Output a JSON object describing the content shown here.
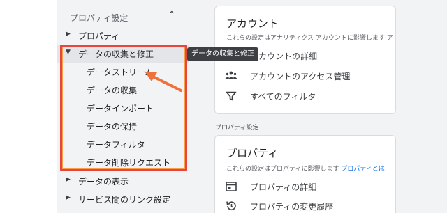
{
  "sidebar": {
    "header": "プロパティ設定",
    "items": [
      {
        "label": "プロパティ",
        "expanded": false
      },
      {
        "label": "データの収集と修正",
        "expanded": true
      },
      {
        "label": "データの表示",
        "expanded": false
      },
      {
        "label": "サービス間のリンク設定",
        "expanded": false
      }
    ],
    "sub_items": [
      "データストリーム",
      "データの収集",
      "データインポート",
      "データの保持",
      "データフィルタ",
      "データ削除リクエスト"
    ]
  },
  "tooltip": "データの収集と修正",
  "account_card": {
    "title": "アカウント",
    "description": "これらの設定はアナリティクス アカウントに影響します",
    "description_suffix": "ア",
    "rows": [
      {
        "label": "アカウントの詳細",
        "icon": "account-details-icon"
      },
      {
        "label": "アカウントのアクセス管理",
        "icon": "people-icon"
      },
      {
        "label": "すべてのフィルタ",
        "icon": "filter-icon"
      }
    ]
  },
  "section_label": "プロパティ設定",
  "property_card": {
    "title": "プロパティ",
    "description": "これらの設定はプロパティに影響します",
    "link": "プロパティとは",
    "rows": [
      {
        "label": "プロパティの詳細",
        "icon": "property-details-icon"
      },
      {
        "label": "プロパティの変更履歴",
        "icon": "history-icon"
      }
    ]
  },
  "colors": {
    "highlight": "#e8453c",
    "arrow": "#f0703c",
    "link": "#1a73e8"
  }
}
